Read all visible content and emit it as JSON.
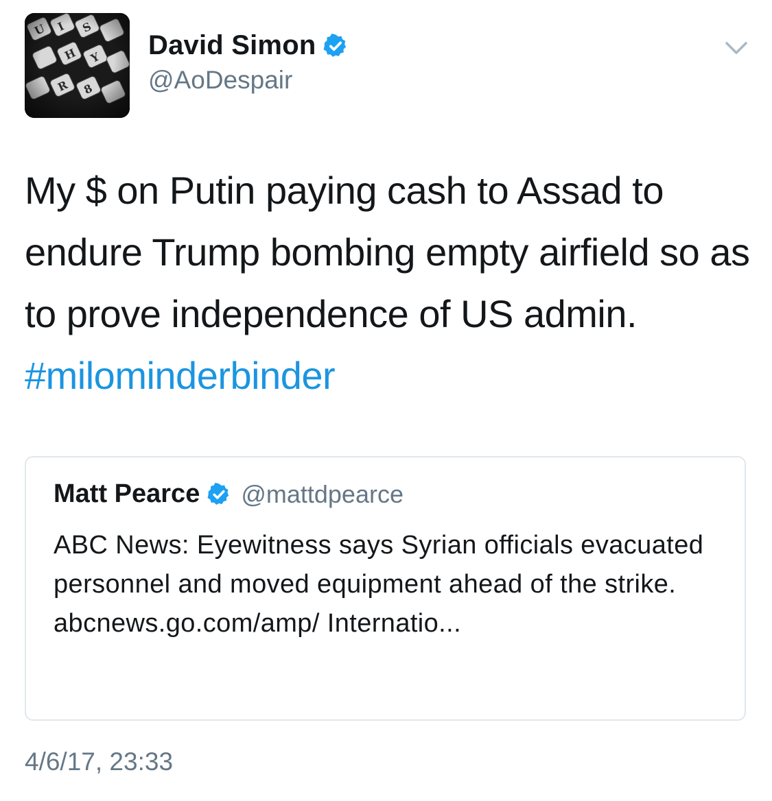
{
  "author": {
    "display_name": "David Simon",
    "handle": "@AoDespair",
    "verified": true,
    "avatar_icon": "typewriter-keys-avatar"
  },
  "menu_icon": "chevron-down-icon",
  "tweet": {
    "text": "My $ on Putin paying cash to Assad to endure Trump bombing empty airfield so as to prove independence of US admin.",
    "hashtag": "#milominderbinder"
  },
  "quoted_tweet": {
    "display_name": "Matt Pearce",
    "handle": "@mattdpearce",
    "verified": true,
    "text": "ABC News: Eyewitness says Syrian officials evacuated personnel and moved equipment ahead of the strike. abcnews.go.com/amp/ Internatio..."
  },
  "timestamp": "4/6/17, 23:33",
  "colors": {
    "link_blue": "#1b95e0",
    "verified_blue": "#1da1f2",
    "secondary_gray": "#657786",
    "border_gray": "#e1e8ed"
  }
}
